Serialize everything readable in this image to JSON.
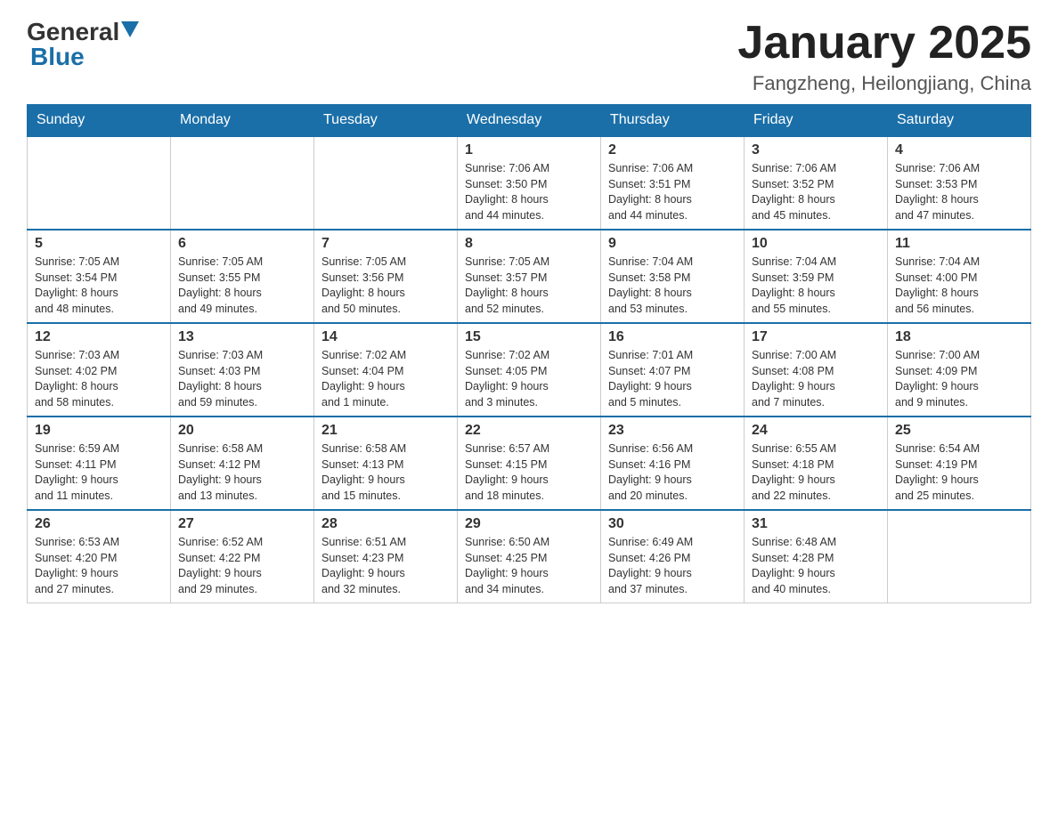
{
  "header": {
    "logo_general": "General",
    "logo_blue": "Blue",
    "month_title": "January 2025",
    "location": "Fangzheng, Heilongjiang, China"
  },
  "days_of_week": [
    "Sunday",
    "Monday",
    "Tuesday",
    "Wednesday",
    "Thursday",
    "Friday",
    "Saturday"
  ],
  "weeks": [
    [
      {
        "day": "",
        "info": ""
      },
      {
        "day": "",
        "info": ""
      },
      {
        "day": "",
        "info": ""
      },
      {
        "day": "1",
        "info": "Sunrise: 7:06 AM\nSunset: 3:50 PM\nDaylight: 8 hours\nand 44 minutes."
      },
      {
        "day": "2",
        "info": "Sunrise: 7:06 AM\nSunset: 3:51 PM\nDaylight: 8 hours\nand 44 minutes."
      },
      {
        "day": "3",
        "info": "Sunrise: 7:06 AM\nSunset: 3:52 PM\nDaylight: 8 hours\nand 45 minutes."
      },
      {
        "day": "4",
        "info": "Sunrise: 7:06 AM\nSunset: 3:53 PM\nDaylight: 8 hours\nand 47 minutes."
      }
    ],
    [
      {
        "day": "5",
        "info": "Sunrise: 7:05 AM\nSunset: 3:54 PM\nDaylight: 8 hours\nand 48 minutes."
      },
      {
        "day": "6",
        "info": "Sunrise: 7:05 AM\nSunset: 3:55 PM\nDaylight: 8 hours\nand 49 minutes."
      },
      {
        "day": "7",
        "info": "Sunrise: 7:05 AM\nSunset: 3:56 PM\nDaylight: 8 hours\nand 50 minutes."
      },
      {
        "day": "8",
        "info": "Sunrise: 7:05 AM\nSunset: 3:57 PM\nDaylight: 8 hours\nand 52 minutes."
      },
      {
        "day": "9",
        "info": "Sunrise: 7:04 AM\nSunset: 3:58 PM\nDaylight: 8 hours\nand 53 minutes."
      },
      {
        "day": "10",
        "info": "Sunrise: 7:04 AM\nSunset: 3:59 PM\nDaylight: 8 hours\nand 55 minutes."
      },
      {
        "day": "11",
        "info": "Sunrise: 7:04 AM\nSunset: 4:00 PM\nDaylight: 8 hours\nand 56 minutes."
      }
    ],
    [
      {
        "day": "12",
        "info": "Sunrise: 7:03 AM\nSunset: 4:02 PM\nDaylight: 8 hours\nand 58 minutes."
      },
      {
        "day": "13",
        "info": "Sunrise: 7:03 AM\nSunset: 4:03 PM\nDaylight: 8 hours\nand 59 minutes."
      },
      {
        "day": "14",
        "info": "Sunrise: 7:02 AM\nSunset: 4:04 PM\nDaylight: 9 hours\nand 1 minute."
      },
      {
        "day": "15",
        "info": "Sunrise: 7:02 AM\nSunset: 4:05 PM\nDaylight: 9 hours\nand 3 minutes."
      },
      {
        "day": "16",
        "info": "Sunrise: 7:01 AM\nSunset: 4:07 PM\nDaylight: 9 hours\nand 5 minutes."
      },
      {
        "day": "17",
        "info": "Sunrise: 7:00 AM\nSunset: 4:08 PM\nDaylight: 9 hours\nand 7 minutes."
      },
      {
        "day": "18",
        "info": "Sunrise: 7:00 AM\nSunset: 4:09 PM\nDaylight: 9 hours\nand 9 minutes."
      }
    ],
    [
      {
        "day": "19",
        "info": "Sunrise: 6:59 AM\nSunset: 4:11 PM\nDaylight: 9 hours\nand 11 minutes."
      },
      {
        "day": "20",
        "info": "Sunrise: 6:58 AM\nSunset: 4:12 PM\nDaylight: 9 hours\nand 13 minutes."
      },
      {
        "day": "21",
        "info": "Sunrise: 6:58 AM\nSunset: 4:13 PM\nDaylight: 9 hours\nand 15 minutes."
      },
      {
        "day": "22",
        "info": "Sunrise: 6:57 AM\nSunset: 4:15 PM\nDaylight: 9 hours\nand 18 minutes."
      },
      {
        "day": "23",
        "info": "Sunrise: 6:56 AM\nSunset: 4:16 PM\nDaylight: 9 hours\nand 20 minutes."
      },
      {
        "day": "24",
        "info": "Sunrise: 6:55 AM\nSunset: 4:18 PM\nDaylight: 9 hours\nand 22 minutes."
      },
      {
        "day": "25",
        "info": "Sunrise: 6:54 AM\nSunset: 4:19 PM\nDaylight: 9 hours\nand 25 minutes."
      }
    ],
    [
      {
        "day": "26",
        "info": "Sunrise: 6:53 AM\nSunset: 4:20 PM\nDaylight: 9 hours\nand 27 minutes."
      },
      {
        "day": "27",
        "info": "Sunrise: 6:52 AM\nSunset: 4:22 PM\nDaylight: 9 hours\nand 29 minutes."
      },
      {
        "day": "28",
        "info": "Sunrise: 6:51 AM\nSunset: 4:23 PM\nDaylight: 9 hours\nand 32 minutes."
      },
      {
        "day": "29",
        "info": "Sunrise: 6:50 AM\nSunset: 4:25 PM\nDaylight: 9 hours\nand 34 minutes."
      },
      {
        "day": "30",
        "info": "Sunrise: 6:49 AM\nSunset: 4:26 PM\nDaylight: 9 hours\nand 37 minutes."
      },
      {
        "day": "31",
        "info": "Sunrise: 6:48 AM\nSunset: 4:28 PM\nDaylight: 9 hours\nand 40 minutes."
      },
      {
        "day": "",
        "info": ""
      }
    ]
  ]
}
